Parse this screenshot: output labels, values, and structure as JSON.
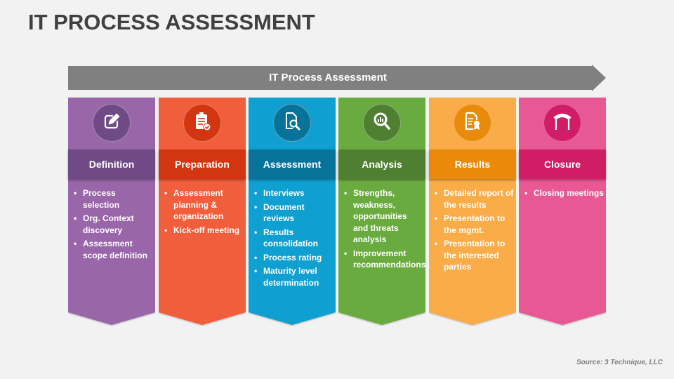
{
  "title": "IT PROCESS ASSESSMENT",
  "arrow_label": "IT Process Assessment",
  "source": "Source: 3 Technique, LLC",
  "columns": [
    {
      "heading": "Definition",
      "icon": "edit-pencil-icon",
      "colors": {
        "body": "#9966aa",
        "band": "#6f4a85",
        "circle": "#6f4a85"
      },
      "items": [
        "Process selection",
        "Org. Context discovery",
        "Assessment scope definition"
      ]
    },
    {
      "heading": "Preparation",
      "icon": "clipboard-check-icon",
      "colors": {
        "body": "#f05e3b",
        "band": "#d2350f",
        "circle": "#d2350f"
      },
      "items": [
        "Assessment planning & organization",
        "Kick-off meeting"
      ]
    },
    {
      "heading": "Assessment",
      "icon": "document-search-icon",
      "colors": {
        "body": "#0f9fd0",
        "band": "#08739a",
        "circle": "#08739a"
      },
      "items": [
        "Interviews",
        "Document reviews",
        "Results consolidation",
        "Process rating",
        "Maturity level determination"
      ]
    },
    {
      "heading": "Analysis",
      "icon": "magnifier-chart-icon",
      "colors": {
        "body": "#6aab3f",
        "band": "#4f7f30",
        "circle": "#4f7f30"
      },
      "items": [
        "Strengths, weakness, opportunities and threats analysis",
        "Improvement recommendations"
      ]
    },
    {
      "heading": "Results",
      "icon": "certificate-document-icon",
      "colors": {
        "body": "#f9ac47",
        "band": "#ea8a0b",
        "circle": "#ea8a0b"
      },
      "items": [
        "Detailed report of the results",
        "Presentation to the mgmt.",
        "Presentation to the interested parties"
      ]
    },
    {
      "heading": "Closure",
      "icon": "finish-arch-icon",
      "colors": {
        "body": "#e85894",
        "band": "#d11d66",
        "circle": "#d11d66"
      },
      "items": [
        "Closing meetings"
      ]
    }
  ]
}
